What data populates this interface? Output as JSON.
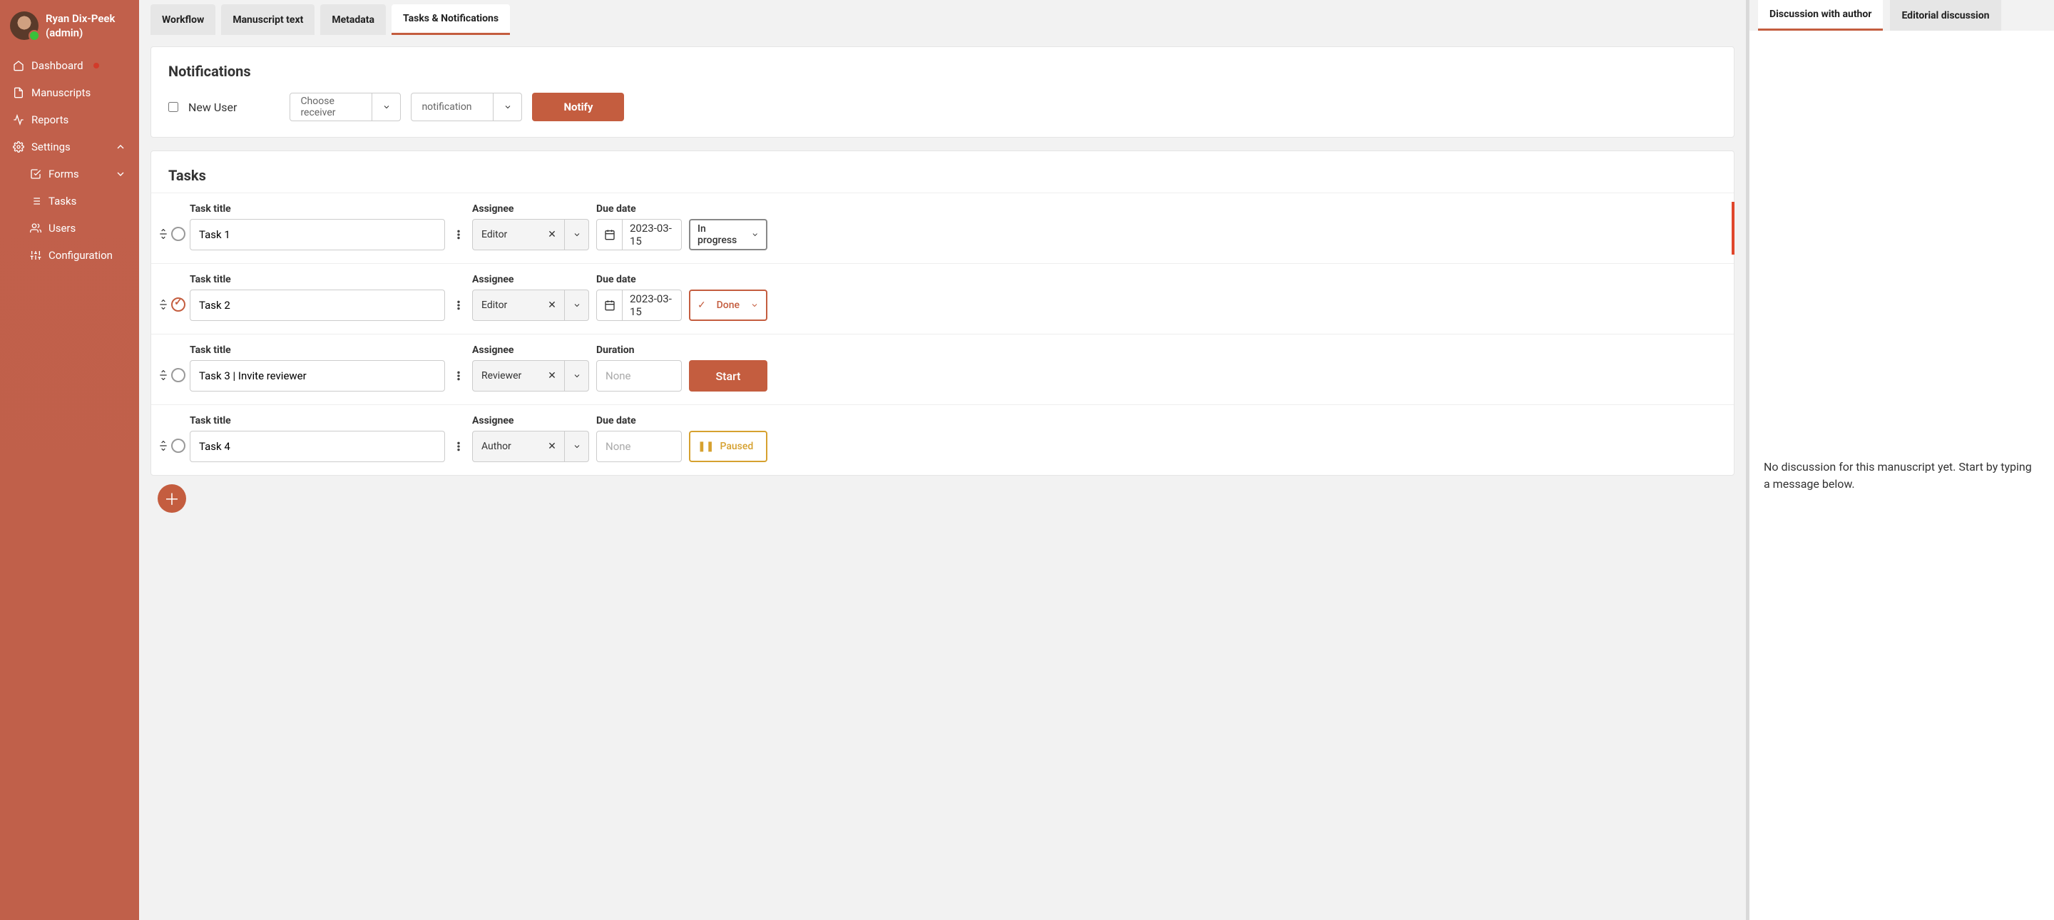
{
  "user": {
    "name": "Ryan Dix-Peek",
    "role": "(admin)"
  },
  "sidebar": {
    "items": [
      {
        "label": "Dashboard",
        "icon": "home-icon",
        "badge": true
      },
      {
        "label": "Manuscripts",
        "icon": "file-icon"
      },
      {
        "label": "Reports",
        "icon": "activity-icon"
      },
      {
        "label": "Settings",
        "icon": "gear-icon",
        "expandable": true,
        "expanded": true
      },
      {
        "label": "Forms",
        "icon": "check-square-icon",
        "sub": true,
        "expandable": true
      },
      {
        "label": "Tasks",
        "icon": "list-icon",
        "sub": true
      },
      {
        "label": "Users",
        "icon": "users-icon",
        "sub": true
      },
      {
        "label": "Configuration",
        "icon": "sliders-icon",
        "sub": true
      }
    ]
  },
  "tabs": [
    {
      "label": "Workflow"
    },
    {
      "label": "Manuscript text"
    },
    {
      "label": "Metadata"
    },
    {
      "label": "Tasks & Notifications",
      "active": true
    }
  ],
  "notifications": {
    "heading": "Notifications",
    "new_user_label": "New User",
    "receiver_placeholder": "Choose receiver",
    "template_placeholder": "notification",
    "notify_button": "Notify"
  },
  "tasks": {
    "heading": "Tasks",
    "labels": {
      "title": "Task title",
      "assignee": "Assignee",
      "duedate": "Due date",
      "duration": "Duration"
    },
    "rows": [
      {
        "title": "Task 1",
        "assignee": "Editor",
        "date_label": "Due date",
        "date": "2023-03-15",
        "status": "In progress",
        "status_type": "inprogress",
        "highlight": true
      },
      {
        "title": "Task 2",
        "assignee": "Editor",
        "date_label": "Due date",
        "date": "2023-03-15",
        "status": "Done",
        "status_type": "done",
        "done": true
      },
      {
        "title": "Task 3 | Invite reviewer",
        "assignee": "Reviewer",
        "date_label": "Duration",
        "date": "",
        "date_placeholder": "None",
        "status": "Start",
        "status_type": "start"
      },
      {
        "title": "Task 4",
        "assignee": "Author",
        "date_label": "Due date",
        "date": "",
        "date_placeholder": "None",
        "status": "Paused",
        "status_type": "paused"
      }
    ]
  },
  "right": {
    "tabs": [
      {
        "label": "Discussion with author",
        "active": true
      },
      {
        "label": "Editorial discussion"
      }
    ],
    "empty_message": "No discussion for this manuscript yet. Start by typing a message below."
  }
}
